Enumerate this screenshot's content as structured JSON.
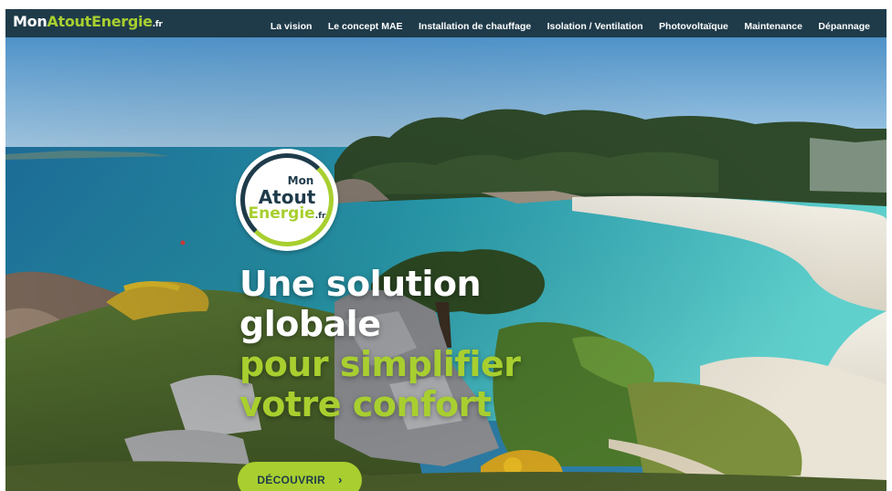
{
  "brand": {
    "logo_part1": "Mon",
    "logo_part2": "Atout",
    "logo_part3": "Energie",
    "logo_suffix": ".fr",
    "accent_color": "#a8cf2f",
    "dark_color": "#1f3b4a"
  },
  "nav": {
    "items": [
      "La vision",
      "Le concept MAE",
      "Installation de chauffage",
      "Isolation / Ventilation",
      "Photovoltaïque",
      "Maintenance",
      "Dépannage"
    ]
  },
  "badge": {
    "line1": "Mon",
    "line2": "Atout",
    "line3": "Energie",
    "line3_suffix": ".fr"
  },
  "hero": {
    "headline_line1": "Une solution",
    "headline_line2": "globale",
    "headline_line3": "pour simplifier",
    "headline_line4": "votre confort",
    "cta_label": "DÉCOUVRIR",
    "cta_icon": "chevron-right-icon"
  }
}
